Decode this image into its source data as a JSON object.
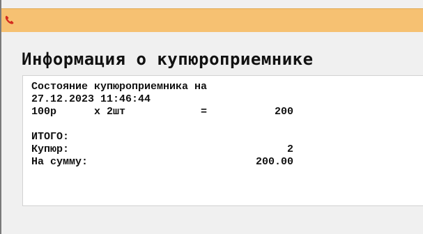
{
  "titlebar": {
    "icon": "phone-icon",
    "color": "#f6c172"
  },
  "heading": "Информация о купюроприемнике",
  "receipt": {
    "status_line": "Состояние купюроприемника на",
    "datetime": "27.12.2023 11:46:44",
    "item": {
      "denomination": "100р",
      "qty": "x 2шт",
      "eq": "=",
      "amount": "200"
    },
    "total_label": "ИТОГО:",
    "bills_label": "Купюр:",
    "bills_value": "2",
    "sum_label": "На сумму:",
    "sum_value": "200.00"
  }
}
